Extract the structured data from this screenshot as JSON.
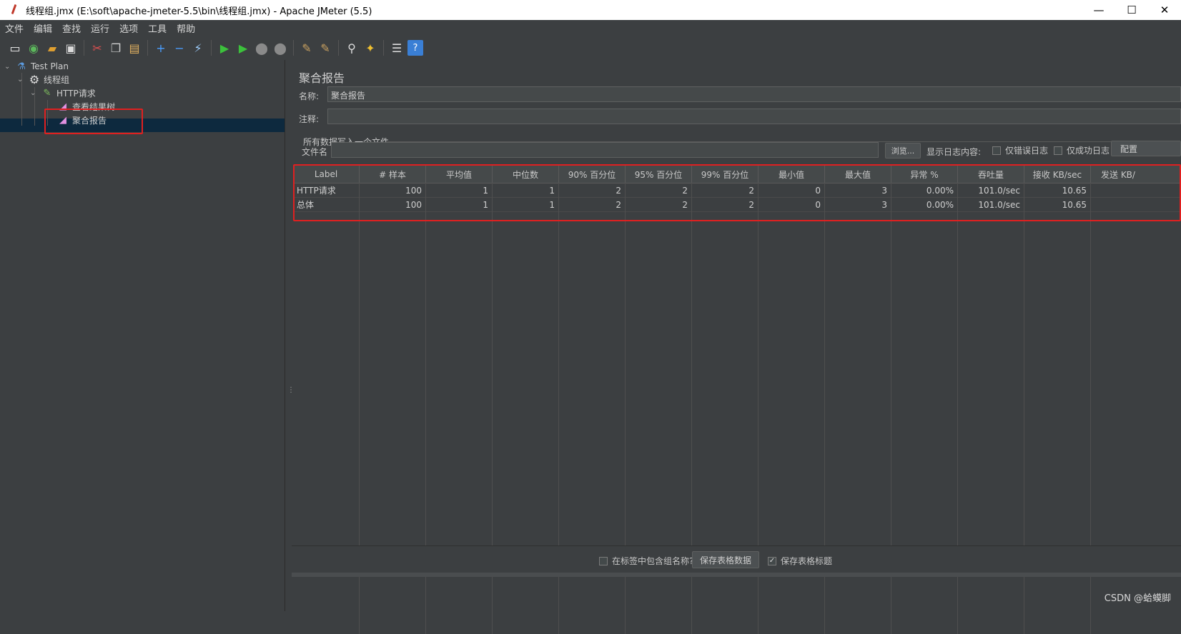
{
  "window": {
    "title": "线程组.jmx (E:\\soft\\apache-jmeter-5.5\\bin\\线程组.jmx) - Apache JMeter (5.5)",
    "minimize": "—",
    "maximize": "☐",
    "close": "✕"
  },
  "menu": [
    "文件",
    "编辑",
    "查找",
    "运行",
    "选项",
    "工具",
    "帮助"
  ],
  "tree": {
    "test_plan": "Test Plan",
    "thread_group": "线程组",
    "http_request": "HTTP请求",
    "view_results_tree": "查看结果树",
    "aggregate_report": "聚合报告"
  },
  "panel": {
    "title": "聚合报告",
    "name_label": "名称:",
    "name_value": "聚合报告",
    "comment_label": "注释:",
    "comment_value": "",
    "file_group_title": "所有数据写入一个文件",
    "file_label": "文件名",
    "file_value": "",
    "browse_button": "浏览...",
    "log_label": "显示日志内容:",
    "errors_only": "仅错误日志",
    "success_only": "仅成功日志",
    "configure_button": "配置"
  },
  "table": {
    "headers": [
      "Label",
      "# 样本",
      "平均值",
      "中位数",
      "90% 百分位",
      "95% 百分位",
      "99% 百分位",
      "最小值",
      "最大值",
      "异常 %",
      "吞吐量",
      "接收 KB/sec",
      "发送 KB/"
    ],
    "rows": [
      [
        "HTTP请求",
        "100",
        "1",
        "1",
        "2",
        "2",
        "2",
        "0",
        "3",
        "0.00%",
        "101.0/sec",
        "10.65",
        ""
      ],
      [
        "总体",
        "100",
        "1",
        "1",
        "2",
        "2",
        "2",
        "0",
        "3",
        "0.00%",
        "101.0/sec",
        "10.65",
        ""
      ]
    ]
  },
  "bottom": {
    "include_group_name": "在标签中包含组名称?",
    "save_table_data": "保存表格数据",
    "save_table_header": "保存表格标题",
    "save_header_checked": "✓"
  },
  "watermark": "CSDN @蛤蟆脚",
  "colors": {
    "background": "#3c3f41",
    "selected_row": "#0d293e",
    "highlight": "#e02020"
  }
}
